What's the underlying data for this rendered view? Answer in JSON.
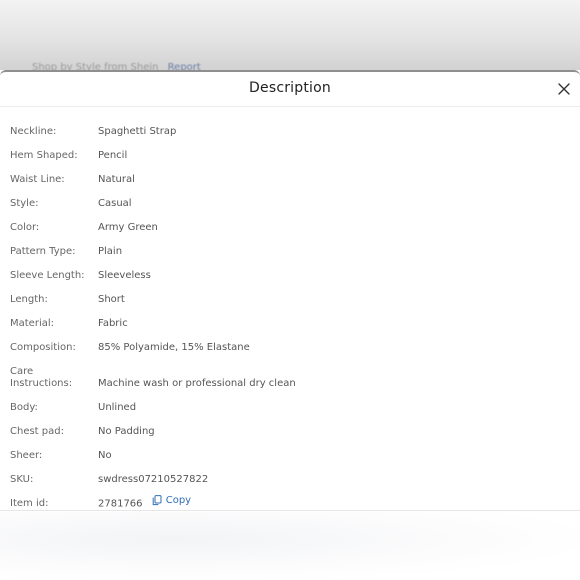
{
  "backdrop": {
    "peek_text": "Shop by Style from Shein",
    "peek_link": "Report"
  },
  "sheet": {
    "title": "Description",
    "close_icon": "close-icon"
  },
  "specs": [
    {
      "label": "Neckline:",
      "value": "Spaghetti Strap"
    },
    {
      "label": "Hem Shaped:",
      "value": "Pencil"
    },
    {
      "label": "Waist Line:",
      "value": "Natural"
    },
    {
      "label": "Style:",
      "value": "Casual"
    },
    {
      "label": "Color:",
      "value": "Army Green"
    },
    {
      "label": "Pattern Type:",
      "value": "Plain"
    },
    {
      "label": "Sleeve Length:",
      "value": "Sleeveless"
    },
    {
      "label": "Length:",
      "value": "Short"
    },
    {
      "label": "Material:",
      "value": "Fabric"
    },
    {
      "label": "Composition:",
      "value": "85% Polyamide, 15% Elastane"
    },
    {
      "label": "Care Instructions:",
      "value": "Machine wash or professional dry clean"
    },
    {
      "label": "Body:",
      "value": "Unlined"
    },
    {
      "label": "Chest pad:",
      "value": "No Padding"
    },
    {
      "label": "Sheer:",
      "value": "No"
    },
    {
      "label": "SKU:",
      "value": "swdress07210527822"
    },
    {
      "label": "Item id:",
      "value": "2781766",
      "copy_label": "Copy",
      "copy_icon": "copy-icon"
    }
  ],
  "colors": {
    "accent": "#2f6fb5",
    "text": "#555555",
    "title": "#222222"
  }
}
